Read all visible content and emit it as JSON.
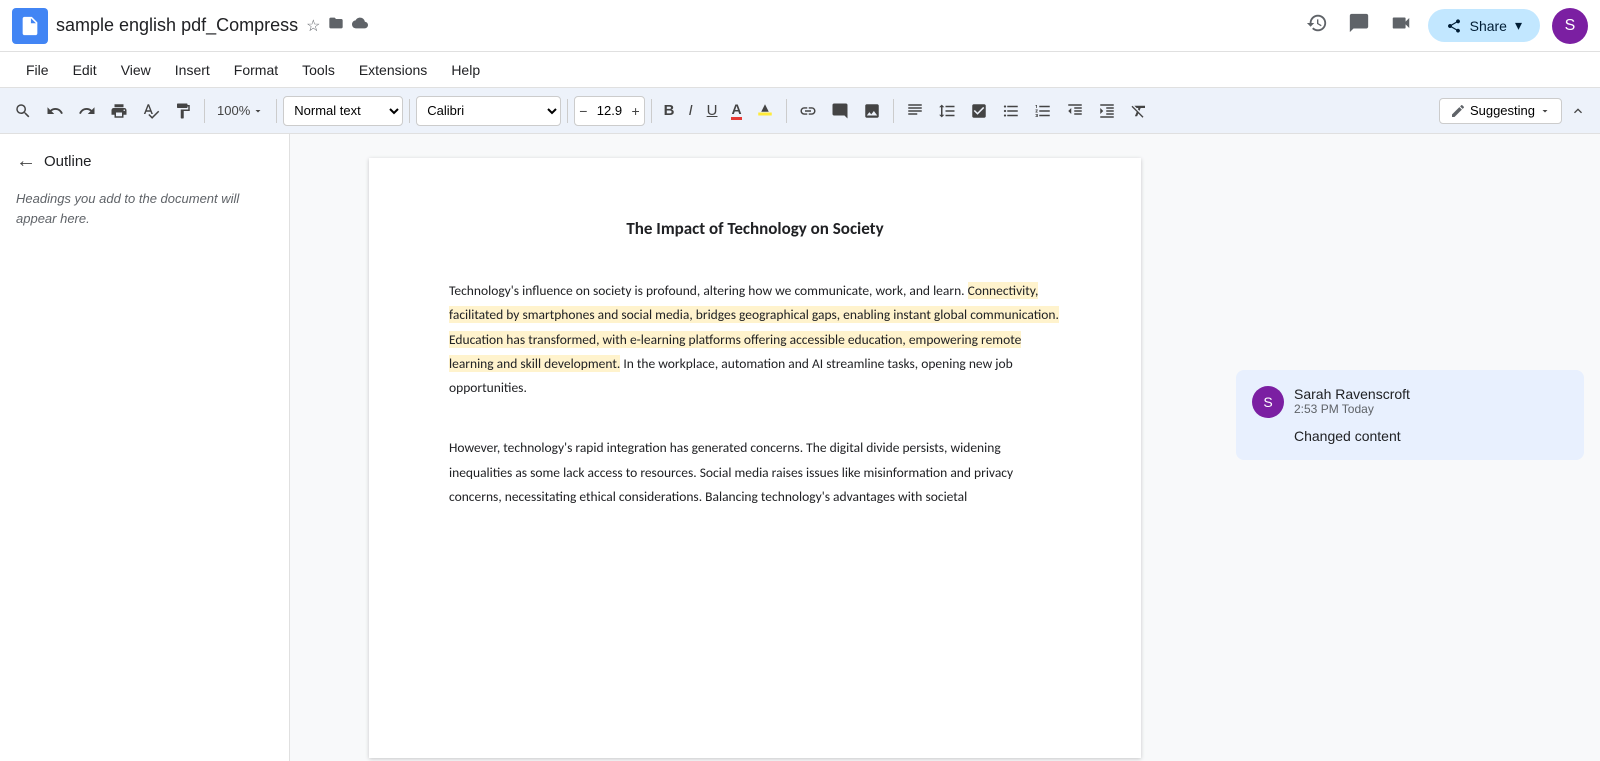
{
  "titlebar": {
    "doc_icon": "📄",
    "doc_title": "sample english pdf_Compress",
    "share_label": "Share",
    "share_caret": "▾",
    "history_icon": "🕐",
    "chat_icon": "💬",
    "meet_icon": "📹",
    "avatar_letter": "S"
  },
  "menubar": {
    "items": [
      "File",
      "Edit",
      "View",
      "Insert",
      "Format",
      "Tools",
      "Extensions",
      "Help"
    ]
  },
  "toolbar": {
    "zoom": "100%",
    "style": "Normal text",
    "font": "Calibri",
    "font_size": "12.9",
    "suggesting_label": "Suggesting",
    "collapse_icon": "⌃"
  },
  "sidebar": {
    "outline_title": "Outline",
    "outline_hint": "Headings you add to the document will appear here."
  },
  "document": {
    "title": "The Impact of Technology on Society",
    "paragraph1_before_highlight": "Technology's influence on society is profound, altering how we communicate, work, and learn. ",
    "paragraph1_highlight": "Connectivity, facilitated by smartphones and social media, bridges geographical gaps, enabling instant global communication. Education has transformed, with e-learning platforms offering accessible education, empowering remote learning and skill development.",
    "paragraph1_after_highlight": " In the workplace, automation and AI streamline tasks, opening new job opportunities.",
    "paragraph2": "However, technology's rapid integration has generated concerns. The digital divide persists, widening inequalities as some lack access to resources. Social media raises issues like misinformation and privacy concerns, necessitating ethical considerations. Balancing technology's advantages with societal"
  },
  "comment": {
    "user": "Sarah Ravenscroft",
    "time": "2:53 PM Today",
    "text": "Changed content",
    "avatar_letter": "S"
  }
}
